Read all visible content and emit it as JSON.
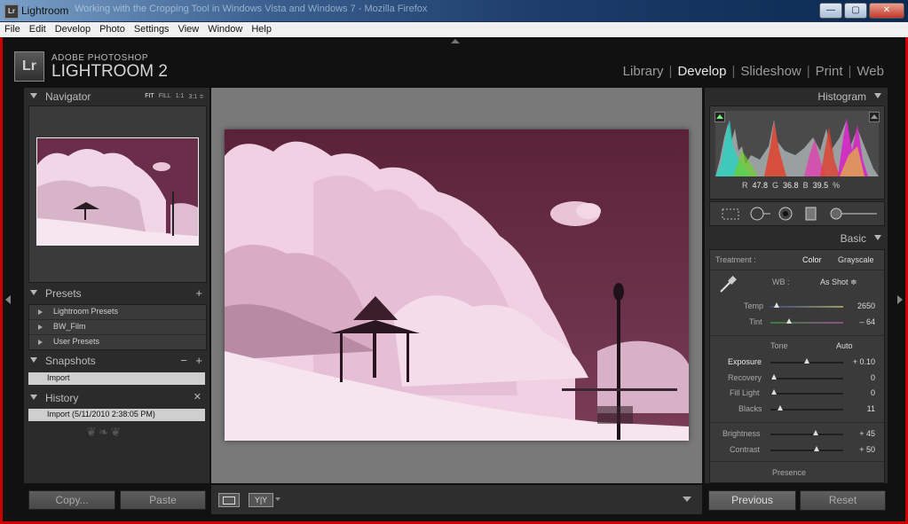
{
  "window": {
    "title": "Lightroom",
    "ghost_title": "Working with the Cropping Tool in Windows Vista and Windows 7 - Mozilla Firefox",
    "icon": "Lr"
  },
  "menu": [
    "File",
    "Edit",
    "Develop",
    "Photo",
    "Settings",
    "View",
    "Window",
    "Help"
  ],
  "identity": {
    "badge": "Lr",
    "line1": "ADOBE PHOTOSHOP",
    "line2": "LIGHTROOM 2"
  },
  "modules": [
    {
      "label": "Library",
      "active": false
    },
    {
      "label": "Develop",
      "active": true
    },
    {
      "label": "Slideshow",
      "active": false
    },
    {
      "label": "Print",
      "active": false
    },
    {
      "label": "Web",
      "active": false
    }
  ],
  "navigator": {
    "title": "Navigator",
    "zoom": [
      "FIT",
      "FILL",
      "1:1",
      "3:1 ≑"
    ],
    "selected_zoom": "FIT"
  },
  "presets": {
    "title": "Presets",
    "items": [
      "Lightroom Presets",
      "BW_Film",
      "User Presets"
    ]
  },
  "snapshots": {
    "title": "Snapshots",
    "items": [
      "Import"
    ]
  },
  "history": {
    "title": "History",
    "items": [
      "Import (5/11/2010 2:38:05 PM)"
    ]
  },
  "left_buttons": {
    "copy": "Copy...",
    "paste": "Paste"
  },
  "histogram": {
    "title": "Histogram",
    "r_label": "R",
    "r_value": "47.8",
    "g_label": "G",
    "g_value": "36.8",
    "b_label": "B",
    "b_value": "39.5",
    "unit": "%"
  },
  "basic": {
    "title": "Basic",
    "treatment_label": "Treatment :",
    "treatment_color": "Color",
    "treatment_grayscale": "Grayscale",
    "wb_label": "WB :",
    "wb_value": "As Shot ≑",
    "tone_label": "Tone",
    "auto_label": "Auto",
    "presence_label": "Presence",
    "sliders": [
      {
        "label": "Temp",
        "value": "2650",
        "pos": 0.08
      },
      {
        "label": "Tint",
        "value": "– 64",
        "pos": 0.25
      },
      {
        "label": "Exposure",
        "value": "+ 0.10",
        "pos": 0.5
      },
      {
        "label": "Recovery",
        "value": "0",
        "pos": 0.05
      },
      {
        "label": "Fill Light",
        "value": "0",
        "pos": 0.05
      },
      {
        "label": "Blacks",
        "value": "11",
        "pos": 0.14
      },
      {
        "label": "Brightness",
        "value": "+ 45",
        "pos": 0.62
      },
      {
        "label": "Contrast",
        "value": "+ 50",
        "pos": 0.63
      }
    ]
  },
  "right_buttons": {
    "previous": "Previous",
    "reset": "Reset"
  },
  "toolbar": {
    "yy": "Y|Y"
  }
}
